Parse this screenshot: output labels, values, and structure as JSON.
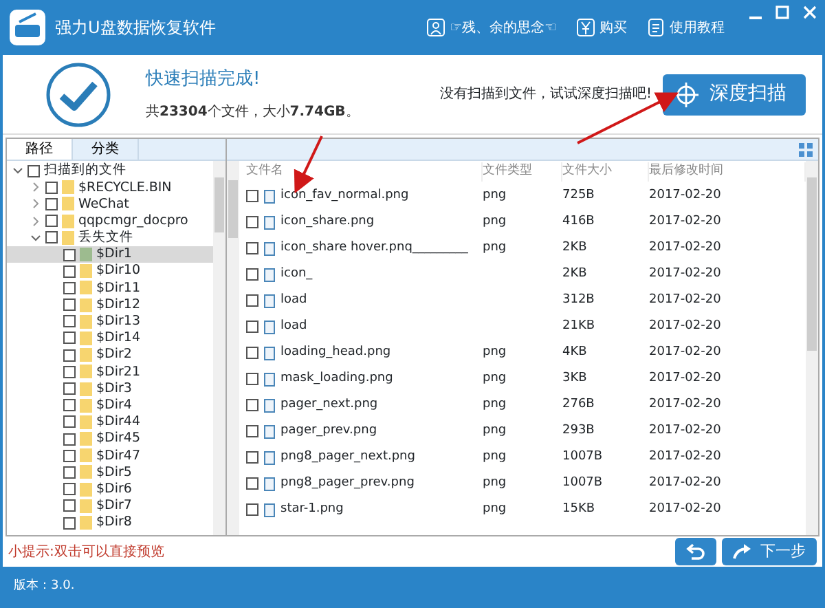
{
  "window": {
    "title": "强力U盘数据恢复软件",
    "menu": [
      {
        "kind": "user",
        "label": "☞残、余的思念☜"
      },
      {
        "kind": "buy",
        "label": "购买"
      },
      {
        "kind": "help",
        "label": "使用教程"
      }
    ]
  },
  "summary": {
    "title": "快速扫描完成!",
    "stats": "共**23304**个文件，大小**7.74GB**。",
    "hint": "没有扫描到文件，试试深度扫描吧!",
    "button": "深度扫描"
  },
  "tabs": [
    {
      "label": "路径",
      "selected": true
    },
    {
      "label": "分类",
      "selected": false
    }
  ],
  "tree": [
    {
      "label": "扫描到的文件",
      "checked": false,
      "expanded": true,
      "selected": false,
      "children": [
        {
          "label": "$RECYCLE.BIN",
          "checked": false,
          "expanded": false,
          "selected": false
        },
        {
          "label": "WeChat",
          "checked": false,
          "expanded": false,
          "selected": false
        },
        {
          "label": "qqpcmgr_docpro",
          "checked": false,
          "expanded": false,
          "selected": false
        },
        {
          "label": "丢失文件",
          "checked": false,
          "expanded": true,
          "selected": false,
          "children": [
            {
              "label": "$Dir1",
              "checked": false,
              "selected": true
            },
            {
              "label": "$Dir10",
              "checked": false,
              "selected": false
            },
            {
              "label": "$Dir11",
              "checked": false,
              "selected": false
            },
            {
              "label": "$Dir12",
              "checked": false,
              "selected": false
            },
            {
              "label": "$Dir13",
              "checked": false,
              "selected": false
            },
            {
              "label": "$Dir14",
              "checked": false,
              "selected": false
            },
            {
              "label": "$Dir2",
              "checked": false,
              "selected": false
            },
            {
              "label": "$Dir21",
              "checked": false,
              "selected": false
            },
            {
              "label": "$Dir3",
              "checked": false,
              "selected": false
            },
            {
              "label": "$Dir4",
              "checked": false,
              "selected": false
            },
            {
              "label": "$Dir44",
              "checked": false,
              "selected": false
            },
            {
              "label": "$Dir45",
              "checked": false,
              "selected": false
            },
            {
              "label": "$Dir47",
              "checked": false,
              "selected": false
            },
            {
              "label": "$Dir5",
              "checked": false,
              "selected": false
            },
            {
              "label": "$Dir6",
              "checked": false,
              "selected": false
            },
            {
              "label": "$Dir7",
              "checked": false,
              "selected": false
            },
            {
              "label": "$Dir8",
              "checked": false,
              "selected": false
            }
          ]
        }
      ]
    }
  ],
  "table": {
    "columns": [
      "文件名",
      "文件类型",
      "文件大小",
      "最后修改时间"
    ],
    "rows": [
      {
        "checked": false,
        "name": "icon_fav_normal.png",
        "type": "png",
        "size": "725B",
        "date": "2017-02-20"
      },
      {
        "checked": false,
        "name": "icon_share.png",
        "type": "png",
        "size": "416B",
        "date": "2017-02-20"
      },
      {
        "checked": false,
        "name": "icon_share hover.pnq_________",
        "type": "png",
        "size": "2KB",
        "date": "2017-02-20"
      },
      {
        "checked": false,
        "name": "icon_",
        "type": "",
        "size": "2KB",
        "date": "2017-02-20"
      },
      {
        "checked": false,
        "name": "load",
        "type": "",
        "size": "312B",
        "date": "2017-02-20"
      },
      {
        "checked": false,
        "name": "load",
        "type": "",
        "size": "21KB",
        "date": "2017-02-20"
      },
      {
        "checked": false,
        "name": "loading_head.png",
        "type": "png",
        "size": "4KB",
        "date": "2017-02-20"
      },
      {
        "checked": false,
        "name": "mask_loading.png",
        "type": "png",
        "size": "3KB",
        "date": "2017-02-20"
      },
      {
        "checked": false,
        "name": "pager_next.png",
        "type": "png",
        "size": "276B",
        "date": "2017-02-20"
      },
      {
        "checked": false,
        "name": "pager_prev.png",
        "type": "png",
        "size": "293B",
        "date": "2017-02-20"
      },
      {
        "checked": false,
        "name": "png8_pager_next.png",
        "type": "png",
        "size": "1007B",
        "date": "2017-02-20"
      },
      {
        "checked": false,
        "name": "png8_pager_prev.png",
        "type": "png",
        "size": "1007B",
        "date": "2017-02-20"
      },
      {
        "checked": false,
        "name": "star-1.png",
        "type": "png",
        "size": "15KB",
        "date": "2017-02-20"
      }
    ]
  },
  "footer": {
    "tip": "小提示:双击可以直接预览",
    "next_button": "下一步"
  },
  "status_bar": "版本：3.0."
}
